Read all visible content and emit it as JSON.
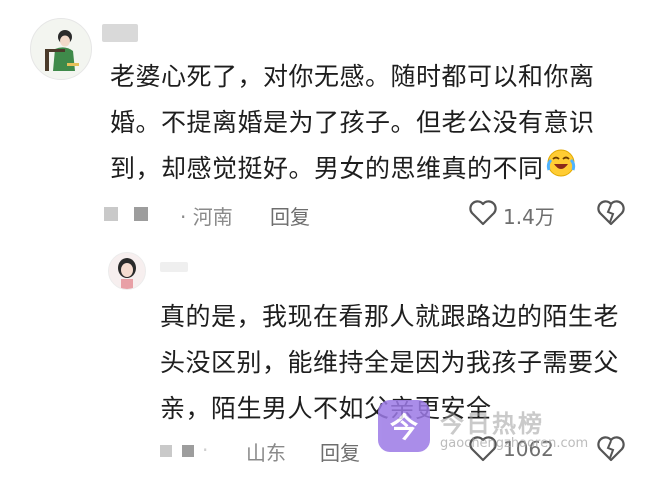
{
  "comment": {
    "text": "老婆心死了，对你无感。随时都可以和你离婚。不提离婚是为了孩子。但老公没有意识到，却感觉挺好。男女的思维真的不同",
    "emoji_icon": "crying-laughing-emoji",
    "location": "· 河南",
    "reply_label": "回复",
    "like_count": "1.4万"
  },
  "reply": {
    "text": "真的是，我现在看那人就跟路边的陌生老头没区别，能维持全是因为我孩子需要父亲，陌生男人不如父亲更安全",
    "location": "山东",
    "reply_label": "回复",
    "like_count": "1062"
  },
  "watermark": {
    "logo_text": "今",
    "title": "今日热榜",
    "url": "gaochengzhaoren.com"
  },
  "colors": {
    "text": "#1e1e1e",
    "meta": "#8a8a8a",
    "watermark": "#9c7ae6"
  }
}
